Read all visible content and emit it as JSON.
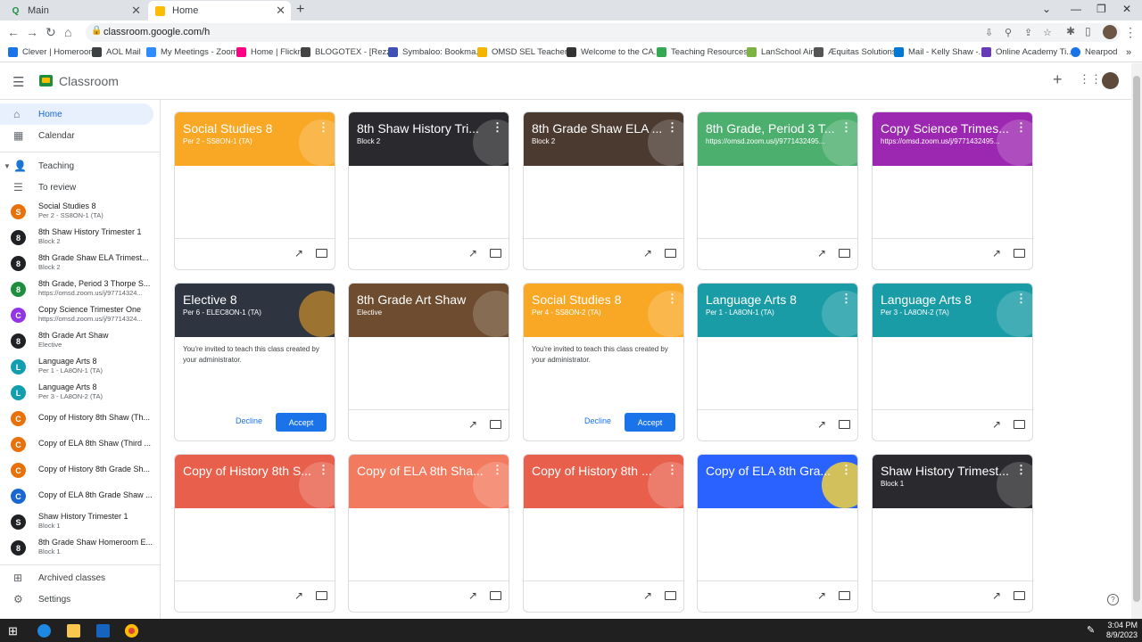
{
  "browser": {
    "tabs": [
      {
        "label": "Main",
        "active": false
      },
      {
        "label": "Home",
        "active": true
      }
    ],
    "url": "classroom.google.com/h",
    "bookmarks": [
      {
        "label": "Clever | Homeroom",
        "color": "#1a73e8"
      },
      {
        "label": "AOL Mail",
        "color": "#3c4043"
      },
      {
        "label": "My Meetings - Zoom",
        "color": "#2d8cff"
      },
      {
        "label": "Home | Flickr",
        "color": "#ff0084"
      },
      {
        "label": "BLOGOTEX - [Rezz...",
        "color": "#444444"
      },
      {
        "label": "Symbaloo: Bookma...",
        "color": "#3f51b5"
      },
      {
        "label": "OMSD SEL Teacher...",
        "color": "#f4b400"
      },
      {
        "label": "Welcome to the CA...",
        "color": "#333333"
      },
      {
        "label": "Teaching Resources...",
        "color": "#34a853"
      },
      {
        "label": "LanSchool Air",
        "color": "#7cb342"
      },
      {
        "label": "Æquitas Solutions",
        "color": "#555555"
      },
      {
        "label": "Mail - Kelly Shaw -...",
        "color": "#0078d4"
      },
      {
        "label": "Online Academy Ti...",
        "color": "#673ab7"
      },
      {
        "label": "Nearpod",
        "color": "#1a73e8"
      }
    ]
  },
  "header": {
    "app_title": "Classroom"
  },
  "sidebar": {
    "home": "Home",
    "calendar": "Calendar",
    "teaching": "Teaching",
    "to_review": "To review",
    "classes": [
      {
        "initial": "S",
        "name": "Social Studies 8",
        "sub": "Per 2 - SS8ON-1 (TA)",
        "color": "#e8710a"
      },
      {
        "initial": "8",
        "name": "8th Shaw History Trimester 1",
        "sub": "Block 2",
        "color": "#202124"
      },
      {
        "initial": "8",
        "name": "8th Grade Shaw ELA Trimest...",
        "sub": "Block 2",
        "color": "#202124"
      },
      {
        "initial": "8",
        "name": "8th Grade, Period 3 Thorpe S...",
        "sub": "https://omsd.zoom.us/j/97714324...",
        "color": "#1e8e3e"
      },
      {
        "initial": "C",
        "name": "Copy Science Trimester One",
        "sub": "https://omsd.zoom.us/j/97714324...",
        "color": "#9334e6"
      },
      {
        "initial": "8",
        "name": "8th Grade Art Shaw",
        "sub": "Elective",
        "color": "#202124"
      },
      {
        "initial": "L",
        "name": "Language Arts 8",
        "sub": "Per 1 - LA8ON-1 (TA)",
        "color": "#129eaf"
      },
      {
        "initial": "L",
        "name": "Language Arts 8",
        "sub": "Per 3 - LA8ON-2 (TA)",
        "color": "#129eaf"
      },
      {
        "initial": "C",
        "name": "Copy of History 8th Shaw (Th...",
        "sub": "",
        "color": "#e8710a"
      },
      {
        "initial": "C",
        "name": "Copy of ELA 8th Shaw (Third ...",
        "sub": "",
        "color": "#e8710a"
      },
      {
        "initial": "C",
        "name": "Copy of History 8th Grade Sh...",
        "sub": "",
        "color": "#e8710a"
      },
      {
        "initial": "C",
        "name": "Copy of ELA 8th Grade Shaw ...",
        "sub": "",
        "color": "#1967d2"
      },
      {
        "initial": "S",
        "name": "Shaw History Trimester 1",
        "sub": "Block 1",
        "color": "#202124"
      },
      {
        "initial": "8",
        "name": "8th Grade Shaw Homeroom E...",
        "sub": "Block 1",
        "color": "#202124"
      }
    ],
    "archived": "Archived classes",
    "settings": "Settings"
  },
  "cards": [
    {
      "title": "Social Studies 8",
      "sub": "Per 2 - SS8ON-1 (TA)",
      "color": "#f9a825",
      "invite": false
    },
    {
      "title": "8th Shaw History Tri...",
      "sub": "Block 2",
      "color": "#2a2a2e",
      "invite": false
    },
    {
      "title": "8th Grade Shaw ELA ...",
      "sub": "Block 2",
      "color": "#4a3a30",
      "invite": false
    },
    {
      "title": "8th Grade, Period 3 T...",
      "sub": "https://omsd.zoom.us/j/9771432495...",
      "color": "#4caf6e",
      "invite": false
    },
    {
      "title": "Copy Science Trimes...",
      "sub": "https://omsd.zoom.us/j/9771432495...",
      "color": "#9c27b0",
      "invite": false
    },
    {
      "title": "Elective 8",
      "sub": "Per 6 - ELEC8ON-1 (TA)",
      "color": "#2e3440",
      "invite": true
    },
    {
      "title": "8th Grade Art Shaw",
      "sub": "Elective",
      "color": "#6d4c2f",
      "invite": false
    },
    {
      "title": "Social Studies 8",
      "sub": "Per 4 - SS8ON-2 (TA)",
      "color": "#f9a825",
      "invite": true
    },
    {
      "title": "Language Arts 8",
      "sub": "Per 1 - LA8ON-1 (TA)",
      "color": "#1a9ca6",
      "invite": false
    },
    {
      "title": "Language Arts 8",
      "sub": "Per 3 - LA8ON-2 (TA)",
      "color": "#1a9ca6",
      "invite": false
    },
    {
      "title": "Copy of History 8th S...",
      "sub": "",
      "color": "#e8604c",
      "invite": false
    },
    {
      "title": "Copy of ELA 8th Sha...",
      "sub": "",
      "color": "#f27a5e",
      "invite": false
    },
    {
      "title": "Copy of History 8th ...",
      "sub": "",
      "color": "#e8604c",
      "invite": false
    },
    {
      "title": "Copy of ELA 8th Gra...",
      "sub": "",
      "color": "#2962ff",
      "invite": false
    },
    {
      "title": "Shaw History Trimest...",
      "sub": "Block 1",
      "color": "#2a2a2e",
      "invite": false
    }
  ],
  "invite": {
    "message": "You're invited to teach this class created by your administrator.",
    "decline": "Decline",
    "accept": "Accept"
  },
  "taskbar": {
    "time": "3:04 PM",
    "date": "8/9/2023"
  }
}
